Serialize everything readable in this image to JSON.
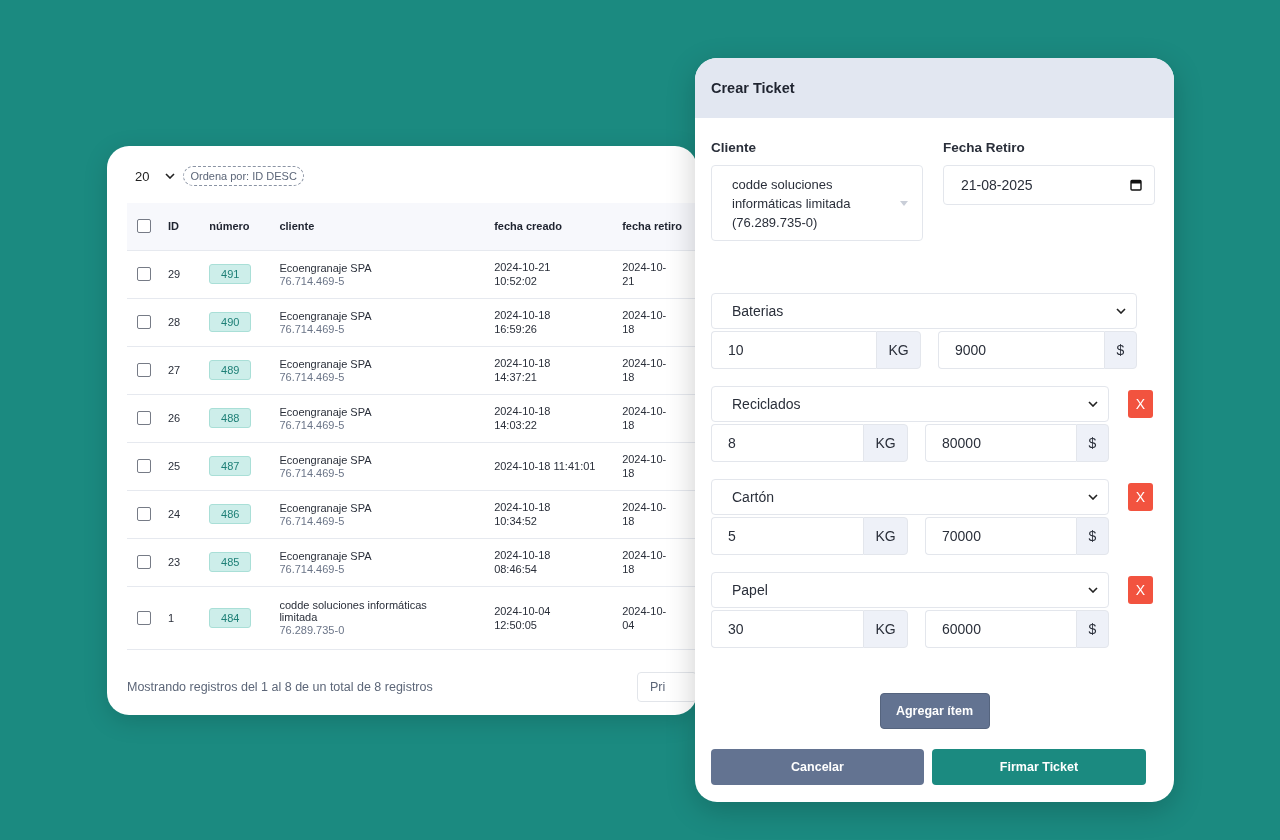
{
  "table_panel": {
    "page_size": "20",
    "sort_badge": "Ordena por: ID DESC",
    "header_checked": false,
    "columns": [
      "ID",
      "número",
      "cliente",
      "fecha creado",
      "fecha retiro"
    ],
    "rows": [
      {
        "checked": false,
        "id": "29",
        "numero": "491",
        "cliente": "Ecoengranaje SPA",
        "rut": "76.714.469-5",
        "fecha_creado": "2024-10-21\n10:52:02",
        "fecha_retiro": "2024-10-\n21"
      },
      {
        "checked": false,
        "id": "28",
        "numero": "490",
        "cliente": "Ecoengranaje SPA",
        "rut": "76.714.469-5",
        "fecha_creado": "2024-10-18\n16:59:26",
        "fecha_retiro": "2024-10-\n18"
      },
      {
        "checked": false,
        "id": "27",
        "numero": "489",
        "cliente": "Ecoengranaje SPA",
        "rut": "76.714.469-5",
        "fecha_creado": "2024-10-18\n14:37:21",
        "fecha_retiro": "2024-10-\n18"
      },
      {
        "checked": false,
        "id": "26",
        "numero": "488",
        "cliente": "Ecoengranaje SPA",
        "rut": "76.714.469-5",
        "fecha_creado": "2024-10-18\n14:03:22",
        "fecha_retiro": "2024-10-\n18"
      },
      {
        "checked": false,
        "id": "25",
        "numero": "487",
        "cliente": "Ecoengranaje SPA",
        "rut": "76.714.469-5",
        "fecha_creado": "2024-10-18 11:41:01",
        "fecha_retiro": "2024-10-\n18"
      },
      {
        "checked": false,
        "id": "24",
        "numero": "486",
        "cliente": "Ecoengranaje SPA",
        "rut": "76.714.469-5",
        "fecha_creado": "2024-10-18\n10:34:52",
        "fecha_retiro": "2024-10-\n18"
      },
      {
        "checked": false,
        "id": "23",
        "numero": "485",
        "cliente": "Ecoengranaje SPA",
        "rut": "76.714.469-5",
        "fecha_creado": "2024-10-18\n08:46:54",
        "fecha_retiro": "2024-10-\n18"
      },
      {
        "checked": false,
        "id": "1",
        "numero": "484",
        "cliente": "codde soluciones informáticas limitada",
        "rut": "76.289.735-0",
        "fecha_creado": "2024-10-04\n12:50:05",
        "fecha_retiro": "2024-10-\n04"
      }
    ],
    "footer": "Mostrando registros del 1 al 8 de un total de 8 registros",
    "pager_button": "Pri"
  },
  "modal": {
    "title": "Crear Ticket",
    "cliente_label": "Cliente",
    "cliente_value": "codde soluciones informáticas limitada (76.289.735-0)",
    "fecha_label": "Fecha Retiro",
    "fecha_value": "21-08-2025",
    "items": [
      {
        "material": "Baterias",
        "quantity": "10",
        "unit": "KG",
        "price": "9000",
        "currency": "$",
        "removable": false
      },
      {
        "material": "Reciclados",
        "quantity": "8",
        "unit": "KG",
        "price": "80000",
        "currency": "$",
        "removable": true,
        "remove_label": "X"
      },
      {
        "material": "Cartón",
        "quantity": "5",
        "unit": "KG",
        "price": "70000",
        "currency": "$",
        "removable": true,
        "remove_label": "X"
      },
      {
        "material": "Papel",
        "quantity": "30",
        "unit": "KG",
        "price": "60000",
        "currency": "$",
        "removable": true,
        "remove_label": "X"
      }
    ],
    "add_button": "Agregar ítem",
    "cancel_button": "Cancelar",
    "submit_button": "Firmar Ticket"
  }
}
